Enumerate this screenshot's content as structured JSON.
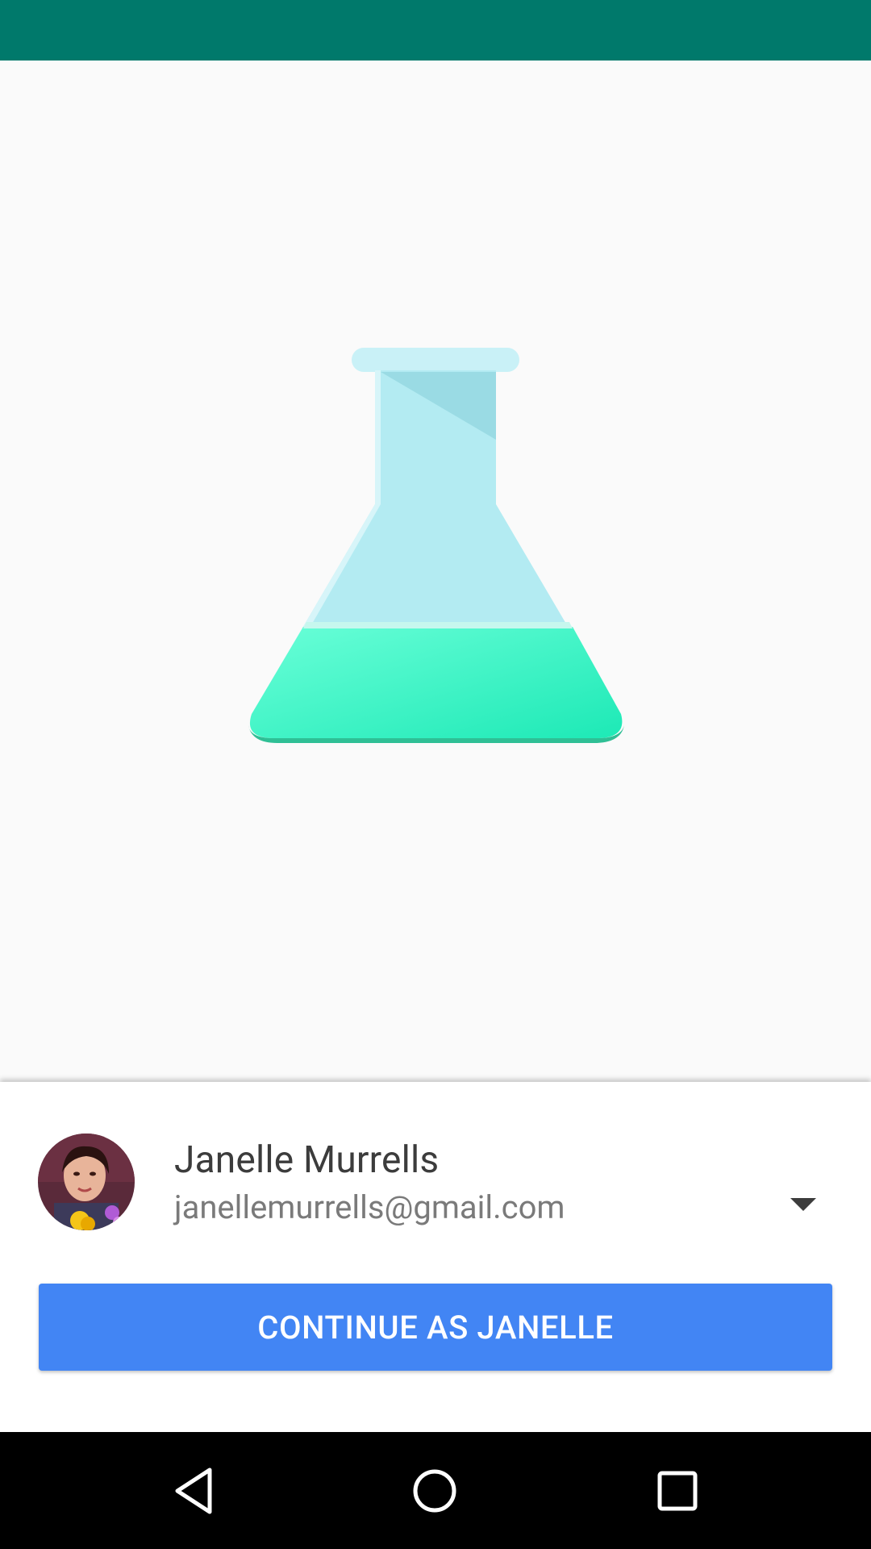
{
  "status_bar": {
    "color": "#00796b"
  },
  "illustration": {
    "icon": "flask-icon"
  },
  "account": {
    "name": "Janelle Murrells",
    "email": "janellemurrells@gmail.com",
    "avatar_icon": "avatar",
    "dropdown_icon": "chevron-down-icon"
  },
  "actions": {
    "continue_label": "CONTINUE AS JANELLE",
    "continue_color": "#4285f4"
  },
  "nav_bar": {
    "back_icon": "back-icon",
    "home_icon": "home-icon",
    "recents_icon": "recents-icon"
  }
}
